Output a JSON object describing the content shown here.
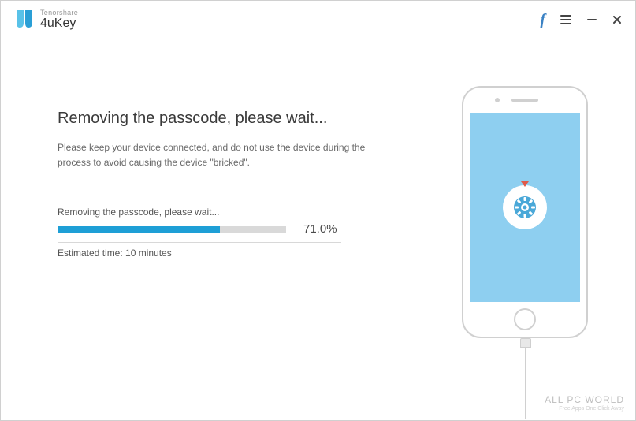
{
  "brand": {
    "company": "Tenorshare",
    "product": "4uKey"
  },
  "main": {
    "heading": "Removing the passcode, please wait...",
    "subtext": "Please keep your device connected, and do not use the device during the process to avoid causing the device \"bricked\".",
    "progress": {
      "label": "Removing the passcode, please wait...",
      "percent_text": "71.0%",
      "percent_value": 71,
      "estimated": "Estimated time: 10 minutes"
    }
  },
  "icons": {
    "facebook": "f",
    "menu": "menu",
    "minimize": "minimize",
    "close": "close",
    "phone": "phone-device",
    "gear": "gear"
  },
  "watermark": {
    "line1": "ALL PC WORLD",
    "line2": "Free Apps One Click Away"
  },
  "colors": {
    "accent": "#1e9fd6",
    "phone_screen": "#8ecff0"
  }
}
